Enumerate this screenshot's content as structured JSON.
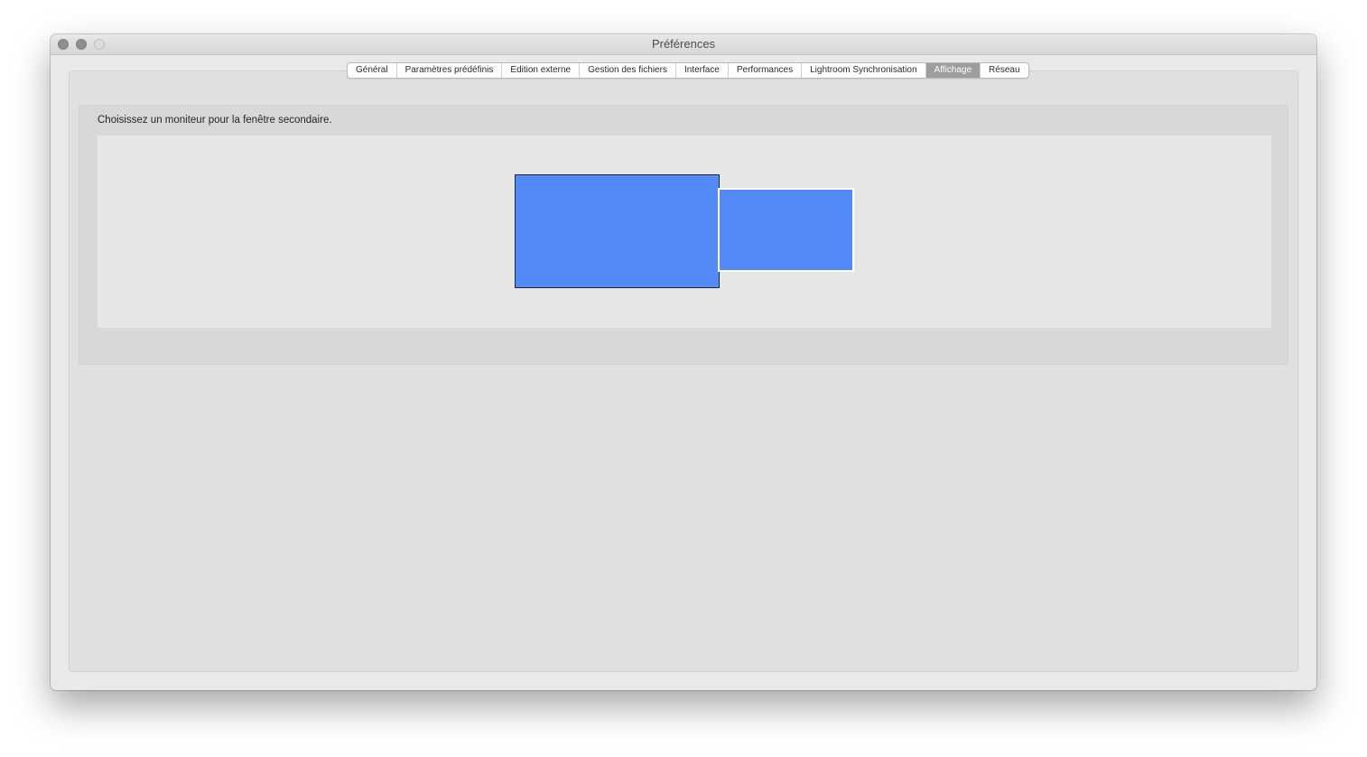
{
  "window": {
    "title": "Préférences"
  },
  "tabs": [
    {
      "label": "Général",
      "active": false
    },
    {
      "label": "Paramètres prédéfinis",
      "active": false
    },
    {
      "label": "Edition externe",
      "active": false
    },
    {
      "label": "Gestion des fichiers",
      "active": false
    },
    {
      "label": "Interface",
      "active": false
    },
    {
      "label": "Performances",
      "active": false
    },
    {
      "label": "Lightroom Synchronisation",
      "active": false
    },
    {
      "label": "Affichage",
      "active": true
    },
    {
      "label": "Réseau",
      "active": false
    }
  ],
  "display": {
    "instruction": "Choisissez un moniteur pour la fenêtre secondaire.",
    "monitors": [
      {
        "role": "primary",
        "selected": false
      },
      {
        "role": "secondary",
        "selected": true
      }
    ]
  },
  "colors": {
    "monitor_fill": "#528bf8",
    "active_tab": "#9d9d9f",
    "window_background": "#e9e9e9"
  }
}
